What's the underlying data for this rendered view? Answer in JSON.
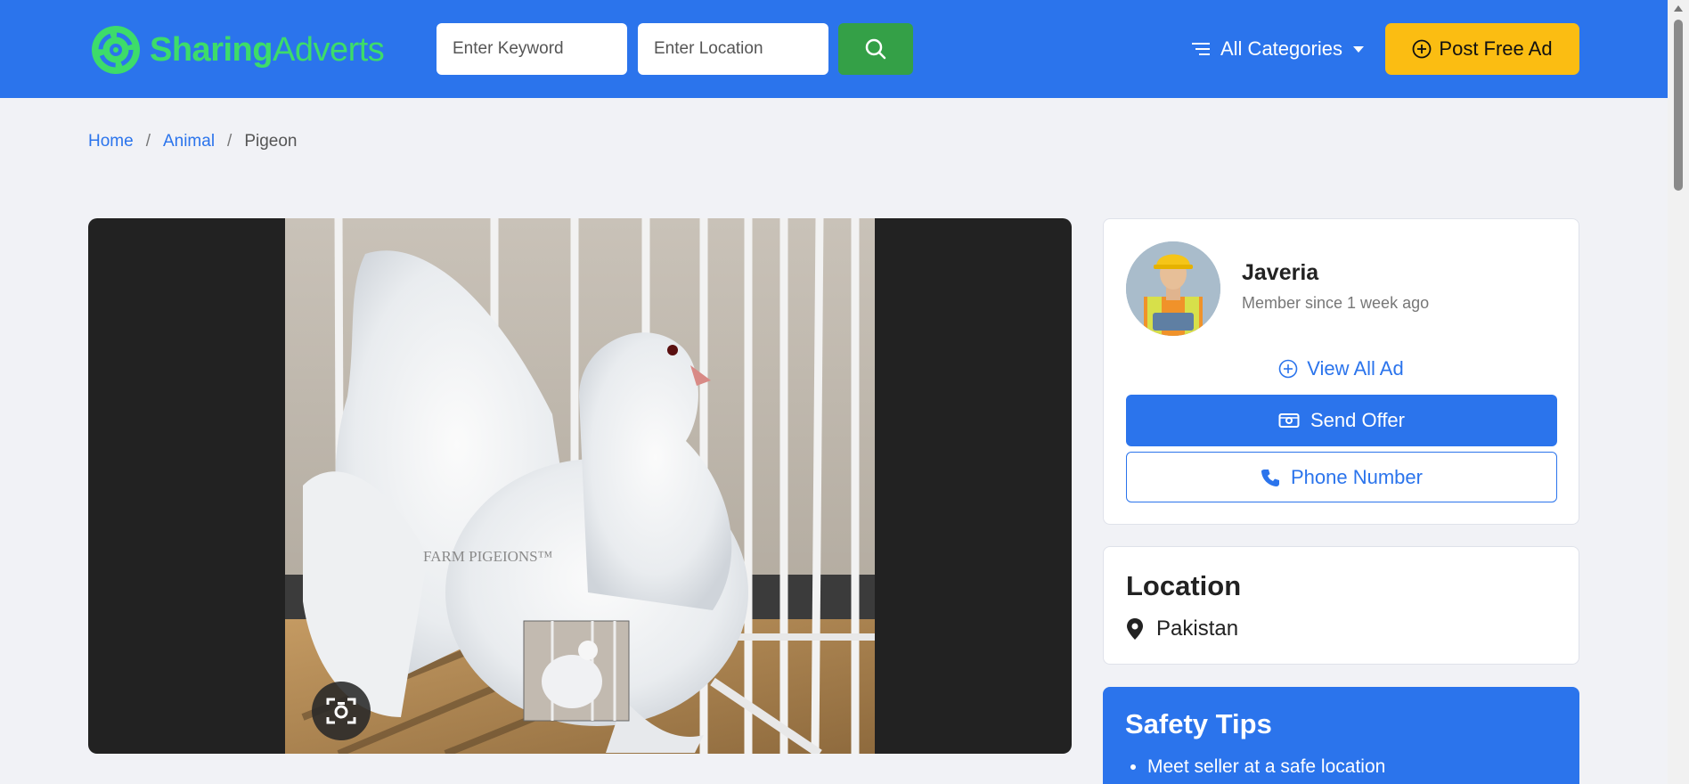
{
  "header": {
    "logo_part1": "Sharing",
    "logo_part2": "Adverts",
    "keyword_placeholder": "Enter Keyword",
    "location_placeholder": "Enter Location",
    "categories_label": "All Categories",
    "post_ad_label": "Post Free Ad"
  },
  "breadcrumb": {
    "items": [
      "Home",
      "Animal",
      "Pigeon"
    ],
    "separator": "/"
  },
  "gallery": {
    "watermark": "FARM PIGEIONS™"
  },
  "seller": {
    "name": "Javeria",
    "member_since": "Member since 1 week ago",
    "view_all_label": "View All Ad",
    "send_offer_label": "Send Offer",
    "phone_label": "Phone Number"
  },
  "location": {
    "title": "Location",
    "value": "Pakistan"
  },
  "safety": {
    "title": "Safety Tips",
    "tips": [
      "Meet seller at a safe location"
    ]
  },
  "colors": {
    "primary": "#2b74ec",
    "accent_yellow": "#fbbd12",
    "search_green": "#34a047",
    "logo_green": "#3ddc6a"
  }
}
